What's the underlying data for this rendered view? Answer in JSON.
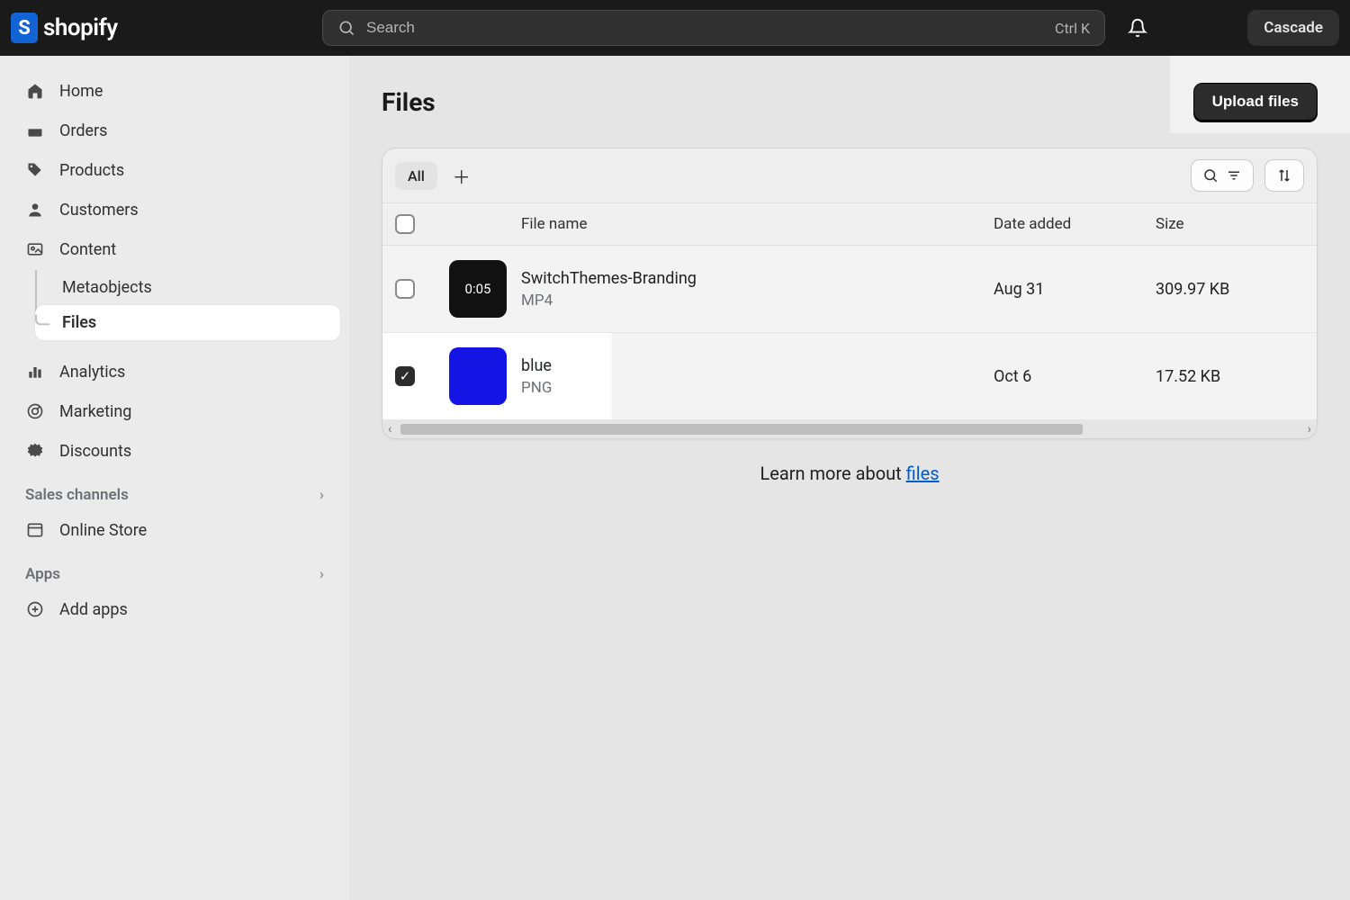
{
  "brand": "shopify",
  "search": {
    "placeholder": "Search",
    "shortcut": "Ctrl K"
  },
  "store_name": "Cascade",
  "sidebar": {
    "main": [
      {
        "label": "Home",
        "icon": "home-icon"
      },
      {
        "label": "Orders",
        "icon": "orders-icon"
      },
      {
        "label": "Products",
        "icon": "products-icon"
      },
      {
        "label": "Customers",
        "icon": "customers-icon"
      },
      {
        "label": "Content",
        "icon": "content-icon"
      }
    ],
    "content_children": [
      {
        "label": "Metaobjects"
      },
      {
        "label": "Files",
        "active": true
      }
    ],
    "secondary": [
      {
        "label": "Analytics",
        "icon": "analytics-icon"
      },
      {
        "label": "Marketing",
        "icon": "marketing-icon"
      },
      {
        "label": "Discounts",
        "icon": "discounts-icon"
      }
    ],
    "sales_head": "Sales channels",
    "sales": [
      {
        "label": "Online Store",
        "icon": "onlinestore-icon"
      }
    ],
    "apps_head": "Apps",
    "apps": [
      {
        "label": "Add apps",
        "icon": "addapps-icon"
      }
    ]
  },
  "page": {
    "title": "Files",
    "upload_label": "Upload files",
    "tab_all": "All"
  },
  "columns": {
    "name": "File name",
    "date": "Date added",
    "size": "Size"
  },
  "files": [
    {
      "name": "SwitchThemes-Branding",
      "type": "MP4",
      "date": "Aug 31",
      "size": "309.97 KB",
      "thumb_kind": "video",
      "duration": "0:05",
      "checked": false
    },
    {
      "name": "blue",
      "type": "PNG",
      "date": "Oct 6",
      "size": "17.52 KB",
      "thumb_kind": "blue",
      "checked": true
    }
  ],
  "learn": {
    "prefix": "Learn more about ",
    "link": "files"
  }
}
